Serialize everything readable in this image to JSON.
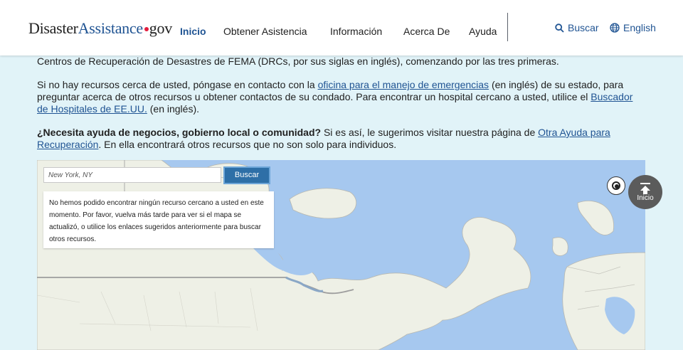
{
  "header": {
    "logo": {
      "part1": "Disaster",
      "part2": "Assistance",
      "part3": "gov"
    },
    "nav": [
      {
        "label": "Inicio",
        "active": true
      },
      {
        "label": "Obtener Asistencia",
        "active": false
      },
      {
        "label": "Información",
        "active": false
      },
      {
        "label": "Acerca De",
        "active": false
      },
      {
        "label": "Ayuda",
        "active": false
      }
    ],
    "search_label": "Buscar",
    "language_label": "English"
  },
  "content": {
    "para1": "Centros de Recuperación de Desastres de FEMA (DRCs, por sus siglas en inglés), comenzando por las tres primeras.",
    "para2_start": "Si no hay recursos cerca de usted, póngase en contacto con la ",
    "para2_link1": "oficina para el manejo de emergencias",
    "para2_mid": " (en inglés) de su estado, para preguntar acerca de otros recursos u obtener contactos de su condado. Para encontrar un hospital cercano a usted, utilice el ",
    "para2_link2": "Buscador de Hospitales de EE.UU.",
    "para2_end": " (en inglés).",
    "para3_bold": "¿Necesita ayuda de negocios, gobierno local o comunidad?",
    "para3_mid": " Si es así, le sugerimos visitar nuestra página de ",
    "para3_link": "Otra Ayuda para Recuperación",
    "para3_end": ". En ella encontrará otros recursos que no son solo para individuos."
  },
  "map": {
    "search_placeholder": "New York, NY",
    "search_button": "Buscar",
    "message": "No hemos podido encontrar ningún recurso cercano a usted en este momento. Por favor, vuelva más tarde para ver si el mapa se actualizó, o utilice los enlaces sugeridos anteriormente para buscar otros recursos.",
    "water_color": "#a6c8ef",
    "land_color": "#eef0e6"
  },
  "back_to_top": {
    "label": "Inicio"
  }
}
